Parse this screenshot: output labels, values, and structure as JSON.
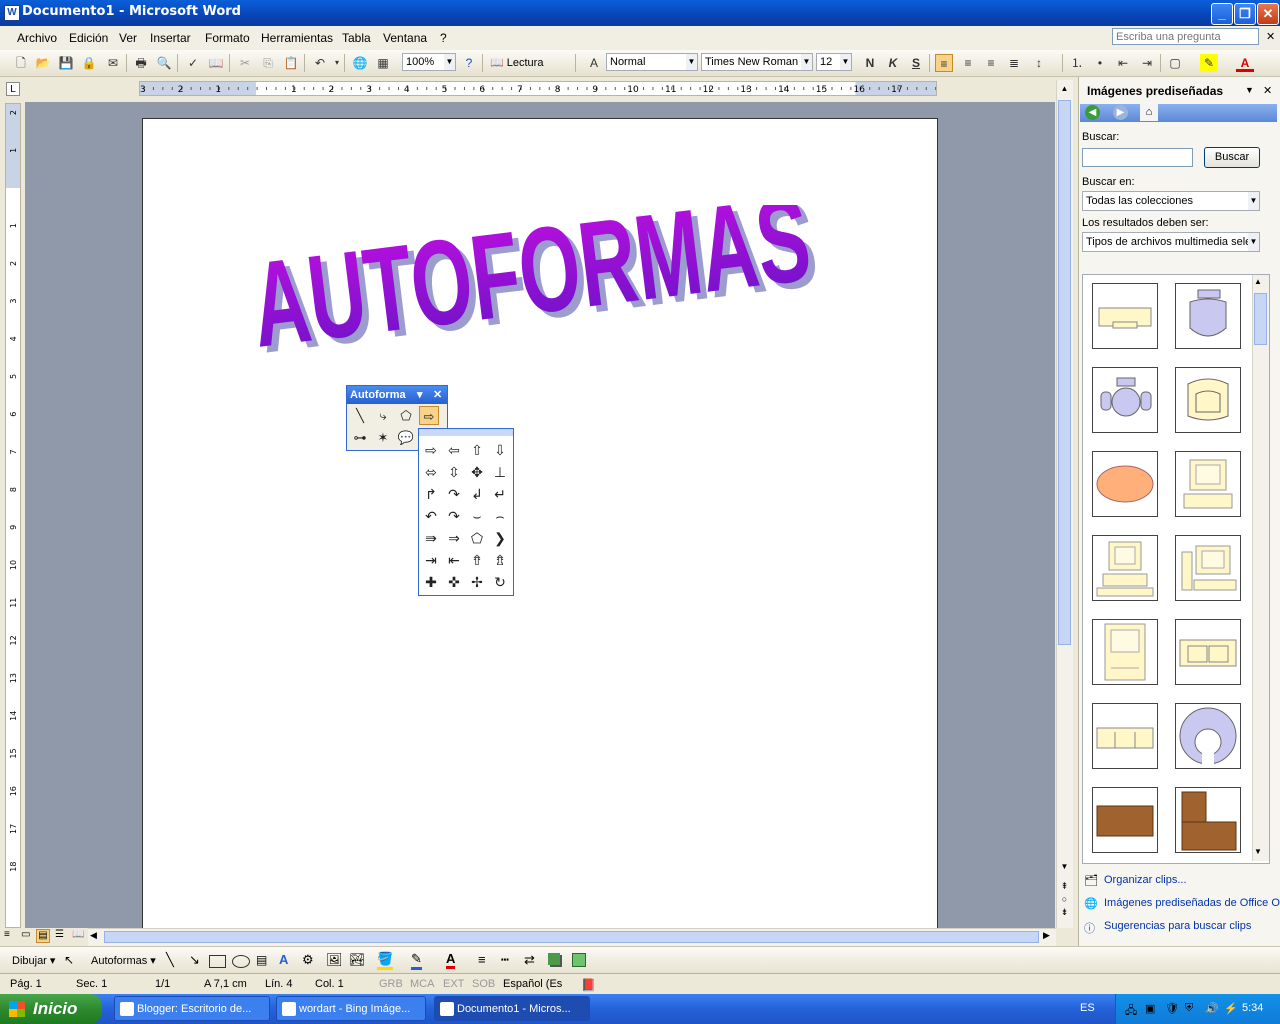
{
  "window": {
    "title": "Documento1 - Microsoft Word",
    "minimize": "_",
    "restore": "❐",
    "close": "✕"
  },
  "menu": {
    "items": [
      "Archivo",
      "Edición",
      "Ver",
      "Insertar",
      "Formato",
      "Herramientas",
      "Tabla",
      "Ventana",
      "?"
    ],
    "ask_placeholder": "Escriba una pregunta"
  },
  "toolbar": {
    "zoom": "100%",
    "reading": "Lectura",
    "style": "Normal",
    "font": "Times New Roman",
    "size": "12",
    "bold": "N",
    "italic": "K",
    "strike": "S"
  },
  "ruler": {
    "horizontal_ticks": [
      "3",
      "2",
      "1",
      "1",
      "2",
      "3",
      "4",
      "5",
      "6",
      "7",
      "8",
      "9",
      "10",
      "11",
      "12",
      "13",
      "14",
      "15",
      "16",
      "17"
    ],
    "vertical_ticks": [
      "2",
      "1",
      "1",
      "2",
      "3",
      "4",
      "5",
      "6",
      "7",
      "8",
      "9",
      "10",
      "11",
      "12",
      "13",
      "14",
      "15",
      "16",
      "17",
      "18"
    ]
  },
  "document": {
    "wordart": "AUTOFORMAS"
  },
  "autoforma": {
    "title": "Autoforma",
    "dropdown": "▾",
    "close": "✕",
    "tools": [
      {
        "name": "lines-tool",
        "glyph": "╲"
      },
      {
        "name": "connectors-tool",
        "glyph": "⤷"
      },
      {
        "name": "basic-shapes-tool",
        "glyph": "⬠"
      },
      {
        "name": "block-arrows-tool",
        "glyph": "⇨"
      },
      {
        "name": "flowchart-tool",
        "glyph": "⊶"
      },
      {
        "name": "stars-banners-tool",
        "glyph": "✶"
      },
      {
        "name": "callouts-tool",
        "glyph": "💬"
      }
    ],
    "palette": [
      [
        "⇨",
        "⇦",
        "⇧",
        "⇩"
      ],
      [
        "⬄",
        "⇳",
        "✥",
        "⊥"
      ],
      [
        "↱",
        "↷",
        "↲",
        "↵"
      ],
      [
        "↶",
        "↷",
        "⌣",
        "⌢"
      ],
      [
        "⇛",
        "⇒",
        "⬠",
        "❯"
      ],
      [
        "⇥",
        "⇤",
        "⇮",
        "⇯"
      ],
      [
        "✚",
        "✜",
        "✢",
        "↻"
      ]
    ]
  },
  "taskpane": {
    "title": "Imágenes prediseñadas",
    "search_label": "Buscar:",
    "search_value": "",
    "search_button": "Buscar",
    "search_in_label": "Buscar en:",
    "search_in_value": "Todas las colecciones",
    "results_label": "Los resultados deben ser:",
    "results_value": "Tipos de archivos multimedia sele",
    "links": [
      "Organizar clips...",
      "Imágenes prediseñadas de Office O",
      "Sugerencias para buscar clips"
    ],
    "clips": [
      "desk-clip",
      "chair-clip",
      "office-chair-clip",
      "armchair-clip",
      "cloud-clip",
      "computer-clip",
      "pc-clip",
      "workstation-clip",
      "mac-clip",
      "sofa-clip",
      "couch-clip",
      "donut-chair-clip",
      "table-clip",
      "l-desk-clip"
    ]
  },
  "drawbar": {
    "draw": "Dibujar ▾",
    "autoshapes": "Autoformas ▾"
  },
  "statusbar": {
    "page": "Pág. 1",
    "section": "Sec. 1",
    "pages": "1/1",
    "at": "A  7,1 cm",
    "line": "Lín.  4",
    "col": "Col.  1",
    "grb": "GRB",
    "mca": "MCA",
    "ext": "EXT",
    "sob": "SOB",
    "lang": "Español (Es"
  },
  "taskbar": {
    "start": "Inicio",
    "tasks": [
      "Blogger: Escritorio de...",
      "wordart - Bing Imáge...",
      "Documento1 - Micros..."
    ],
    "lang": "ES",
    "clock": "5:34"
  },
  "colors": {
    "wordart_top": "#b000d8",
    "wordart_bottom": "#5a10c8",
    "accent": "#2660d0"
  }
}
